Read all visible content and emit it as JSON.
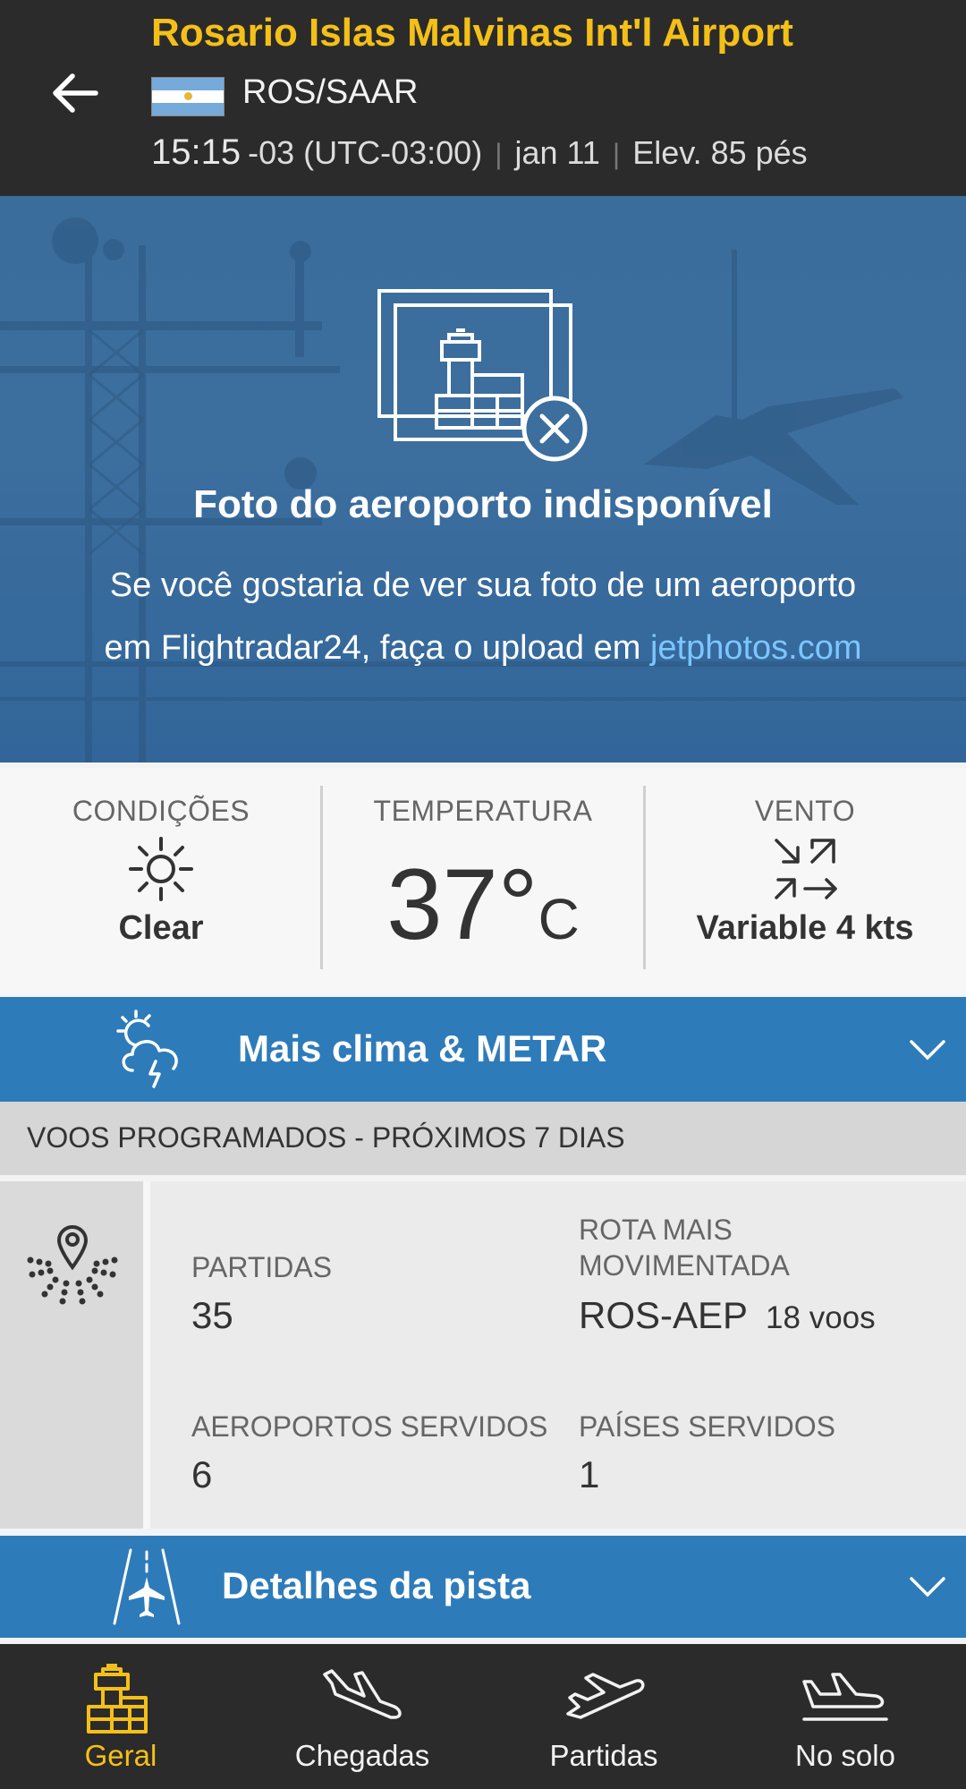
{
  "header": {
    "title": "Rosario Islas Malvinas Int'l Airport",
    "code": "ROS/SAAR",
    "time": "15:15",
    "timezone": "-03 (UTC-03:00)",
    "date": "jan 11",
    "elevation": "Elev. 85 pés",
    "flag": "argentina-flag"
  },
  "banner": {
    "title": "Foto do aeroporto indisponível",
    "text_line1": "Se você gostaria de ver sua foto de um aeroporto",
    "text_line2": "em Flightradar24, faça o upload em ",
    "link": "jetphotos.com"
  },
  "weather": {
    "conditions_label": "CONDIÇÕES",
    "conditions_value": "Clear",
    "temperature_label": "TEMPERATURA",
    "temperature_value": "37°",
    "temperature_unit": "C",
    "wind_label": "VENTO",
    "wind_value": "Variable 4 kts"
  },
  "weather_bar": {
    "label": "Mais clima & METAR"
  },
  "scheduled": {
    "header": "VOOS PROGRAMADOS - PRÓXIMOS 7 DIAS",
    "departures_label": "PARTIDAS",
    "departures_value": "35",
    "busiest_route_label_1": "ROTA MAIS",
    "busiest_route_label_2": "MOVIMENTADA",
    "busiest_route_value": "ROS-AEP",
    "busiest_route_flights": "18 voos",
    "airports_served_label": "AEROPORTOS SERVIDOS",
    "airports_served_value": "6",
    "countries_served_label": "PAÍSES SERVIDOS",
    "countries_served_value": "1"
  },
  "runway_bar": {
    "label": "Detalhes da pista"
  },
  "nav": {
    "items": [
      {
        "label": "Geral",
        "icon": "control-tower-icon"
      },
      {
        "label": "Chegadas",
        "icon": "arrival-plane-icon"
      },
      {
        "label": "Partidas",
        "icon": "departure-plane-icon"
      },
      {
        "label": "No solo",
        "icon": "ground-plane-icon"
      }
    ],
    "active_color": "#f4c018"
  },
  "colors": {
    "header_bg": "#2b2b2b",
    "title_accent": "#f4c018",
    "bar_blue": "#2e7bba",
    "link": "#7cc6ff"
  }
}
